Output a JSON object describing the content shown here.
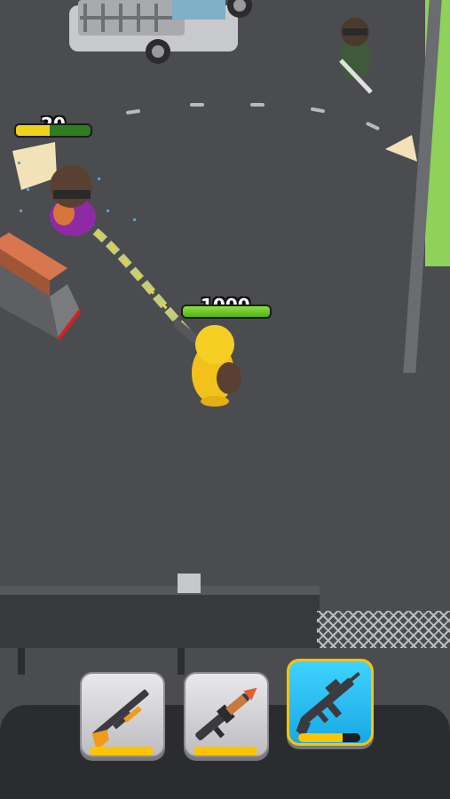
{
  "hud": {
    "enemy_hp_label": "20",
    "enemy_hp_fraction": 0.45,
    "player_hp_label": "1000",
    "player_hp_fraction": 1.0
  },
  "weapons": [
    {
      "name": "shotgun-icon",
      "selected": false,
      "charge_fraction": 1.0
    },
    {
      "name": "rocket-launcher-icon",
      "selected": false,
      "charge_fraction": 1.0
    },
    {
      "name": "assault-rifle-icon",
      "selected": true,
      "charge_fraction": 0.72
    }
  ],
  "colors": {
    "ground": "#4b4c50",
    "hp_green": "#55b021",
    "hp_yellow": "#f0d21a",
    "selected_slot": "#19a9e4",
    "charge_yellow": "#ffc400",
    "player_yellow": "#f2c21a"
  }
}
